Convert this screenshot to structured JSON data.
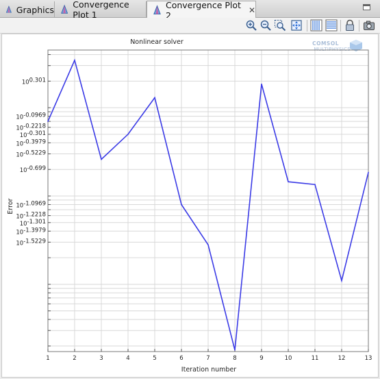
{
  "tabs": [
    {
      "label": "Graphics",
      "icon": "graphics-icon",
      "active": false
    },
    {
      "label": "Convergence Plot 1",
      "icon": "plot-icon",
      "active": false
    },
    {
      "label": "Convergence Plot 2",
      "icon": "plot-icon",
      "active": true
    }
  ],
  "toolbar": [
    {
      "name": "zoom-in-button",
      "icon": "zoom-in-icon"
    },
    {
      "name": "zoom-out-button",
      "icon": "zoom-out-icon"
    },
    {
      "name": "zoom-box-button",
      "icon": "zoom-box-icon"
    },
    {
      "name": "zoom-extents-button",
      "icon": "zoom-extents-icon"
    },
    {
      "name": "x-grid-button",
      "icon": "vertical-grid-icon"
    },
    {
      "name": "y-grid-button",
      "icon": "horizontal-grid-icon"
    },
    {
      "name": "lock-axis-button",
      "icon": "lock-icon"
    },
    {
      "name": "image-snapshot-button",
      "icon": "camera-icon"
    }
  ],
  "logo": {
    "line1": "COMSOL",
    "line2": "MULTIPHYSICS"
  },
  "colors": {
    "line": "#3a3ae6",
    "grid": "#d8d8d8",
    "accent": "#2e6fd6"
  },
  "chart_data": {
    "type": "line",
    "title": "Nonlinear solver",
    "xlabel": "Iteration number",
    "ylabel": "Error",
    "y_scale": "log",
    "grid": true,
    "x": [
      1,
      2,
      3,
      4,
      5,
      6,
      7,
      8,
      9,
      10,
      11,
      12,
      13
    ],
    "values": [
      0.7,
      3.45,
      0.26,
      0.5,
      1.3,
      0.08,
      0.028,
      0.0018,
      1.85,
      0.145,
      0.135,
      0.011,
      0.185
    ],
    "xlim": [
      1,
      13
    ],
    "ylim": [
      0.00173,
      4.5
    ],
    "y_ticks": [
      {
        "value": 2.0,
        "exponent": "0.301"
      },
      {
        "value": 0.8,
        "exponent": "-0.0969"
      },
      {
        "value": 0.6,
        "exponent": "-0.2218"
      },
      {
        "value": 0.5,
        "exponent": "-0.301"
      },
      {
        "value": 0.4,
        "exponent": "-0.3979"
      },
      {
        "value": 0.3,
        "exponent": "-0.5229"
      },
      {
        "value": 0.2,
        "exponent": "-0.699"
      },
      {
        "value": 0.08,
        "exponent": "-1.0969"
      },
      {
        "value": 0.06,
        "exponent": "-1.2218"
      },
      {
        "value": 0.05,
        "exponent": "-1.301"
      },
      {
        "value": 0.04,
        "exponent": "-1.3979"
      },
      {
        "value": 0.03,
        "exponent": "-1.5229"
      }
    ],
    "y_tick_base": "10"
  }
}
